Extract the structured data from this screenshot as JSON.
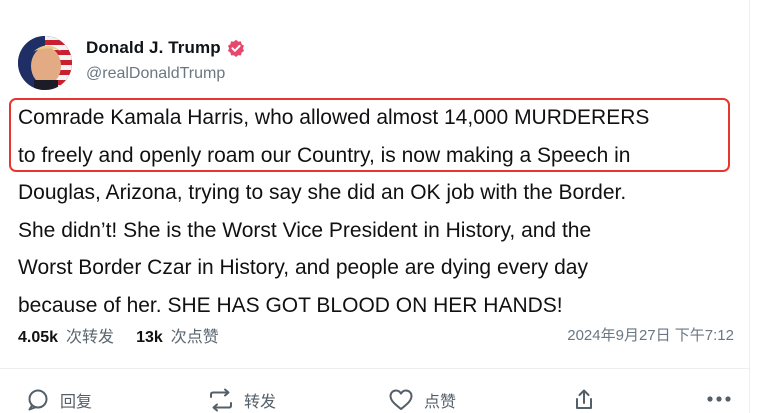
{
  "author": {
    "display_name": "Donald J. Trump",
    "handle": "@realDonaldTrump",
    "verified": true,
    "verified_color": "#e5486c"
  },
  "post": {
    "lines": [
      "Comrade Kamala Harris, who allowed almost 14,000 MURDERERS",
      "to freely and openly roam our Country, is now making a Speech in",
      "Douglas, Arizona, trying to say she did an OK job with the Border.",
      "She didn’t! She is the Worst Vice President in History, and the",
      "Worst Border Czar in History, and people are dying every day",
      "because of her. SHE HAS GOT BLOOD ON HER HANDS!"
    ],
    "highlight_color": "#e5372f"
  },
  "stats": {
    "reposts_count": "4.05k",
    "reposts_label": "次转发",
    "likes_count": "13k",
    "likes_label": "次点赞"
  },
  "timestamp": "2024年9月27日 下午7:12",
  "actions": {
    "reply_label": "回复",
    "repost_label": "转发",
    "like_label": "点赞",
    "share_icon": "share-icon",
    "more_icon": "more-icon"
  }
}
